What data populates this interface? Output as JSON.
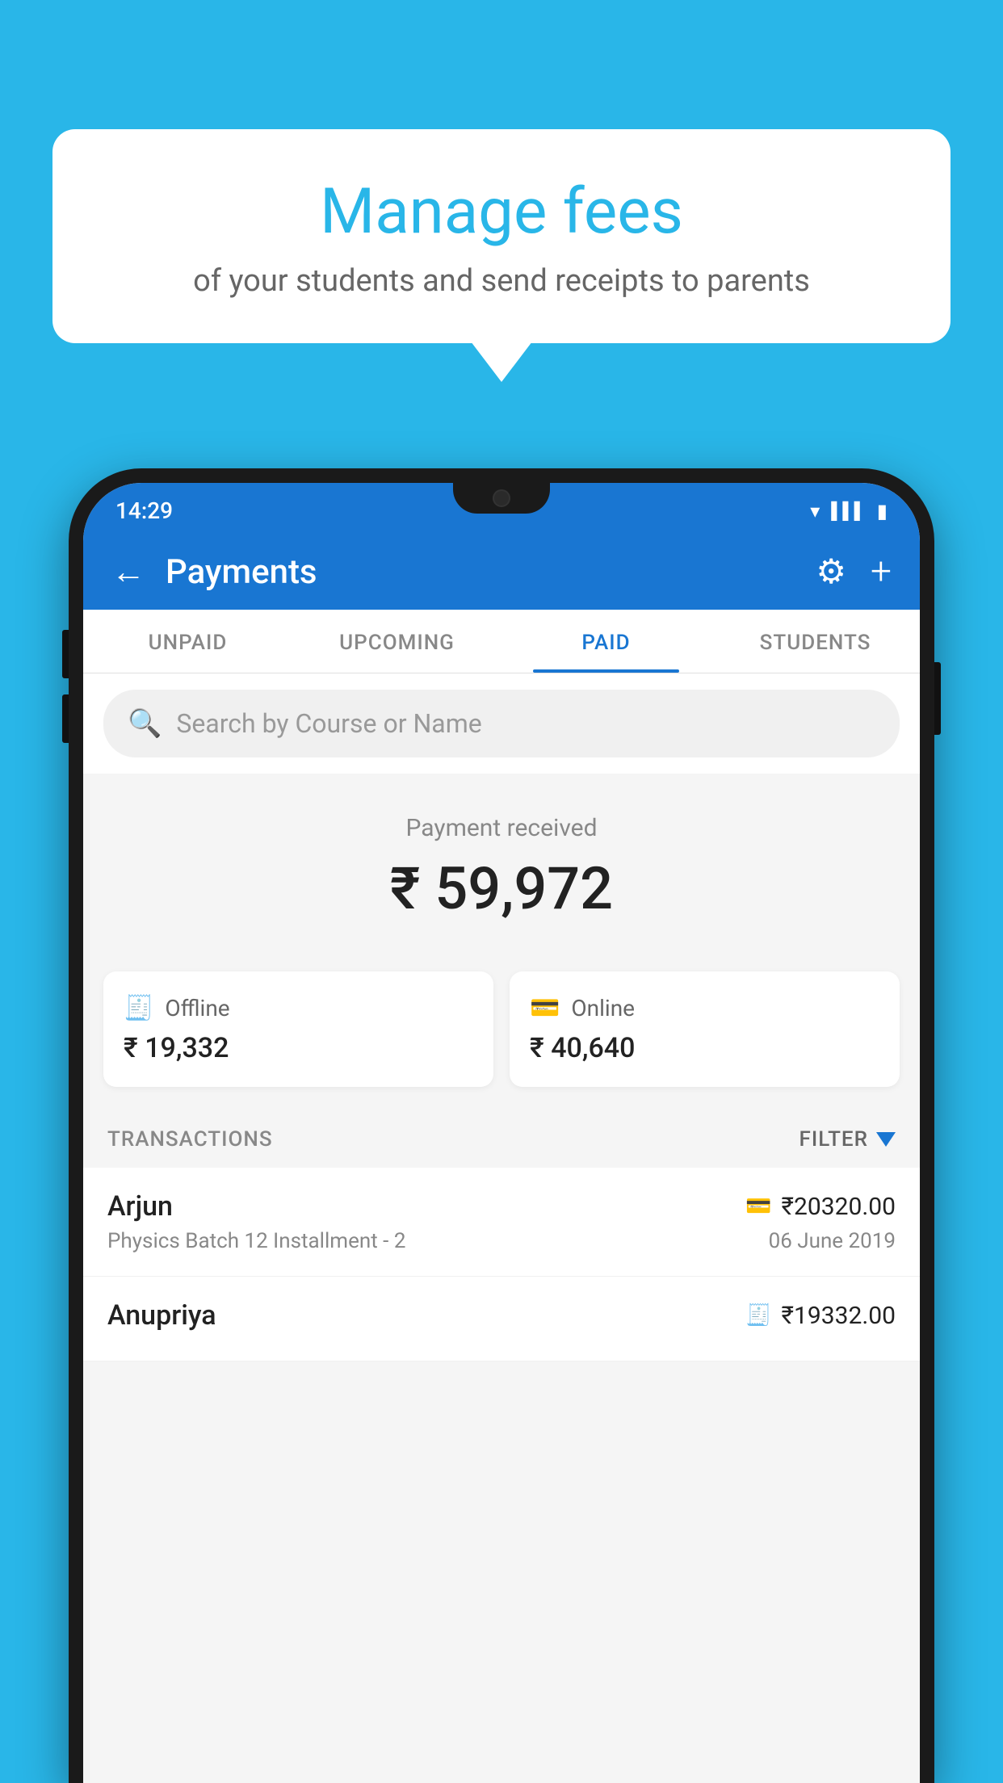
{
  "background": {
    "color": "#29B6E8"
  },
  "speech_bubble": {
    "title": "Manage fees",
    "subtitle": "of your students and send receipts to parents"
  },
  "phone": {
    "status_bar": {
      "time": "14:29",
      "wifi": "wifi",
      "signal": "signal",
      "battery": "battery"
    },
    "app_bar": {
      "title": "Payments",
      "back_label": "←",
      "gear_label": "⚙",
      "plus_label": "+"
    },
    "tabs": [
      {
        "label": "UNPAID",
        "active": false
      },
      {
        "label": "UPCOMING",
        "active": false
      },
      {
        "label": "PAID",
        "active": true
      },
      {
        "label": "STUDENTS",
        "active": false
      }
    ],
    "search": {
      "placeholder": "Search by Course or Name"
    },
    "payment_received": {
      "label": "Payment received",
      "amount": "₹ 59,972",
      "offline": {
        "icon": "offline-payment-icon",
        "label": "Offline",
        "amount": "₹ 19,332"
      },
      "online": {
        "icon": "online-payment-icon",
        "label": "Online",
        "amount": "₹ 40,640"
      }
    },
    "transactions": {
      "header": "TRANSACTIONS",
      "filter_label": "FILTER",
      "rows": [
        {
          "name": "Arjun",
          "course": "Physics Batch 12 Installment - 2",
          "amount": "₹20320.00",
          "date": "06 June 2019",
          "payment_type": "online"
        },
        {
          "name": "Anupriya",
          "course": "",
          "amount": "₹19332.00",
          "date": "",
          "payment_type": "offline"
        }
      ]
    }
  }
}
